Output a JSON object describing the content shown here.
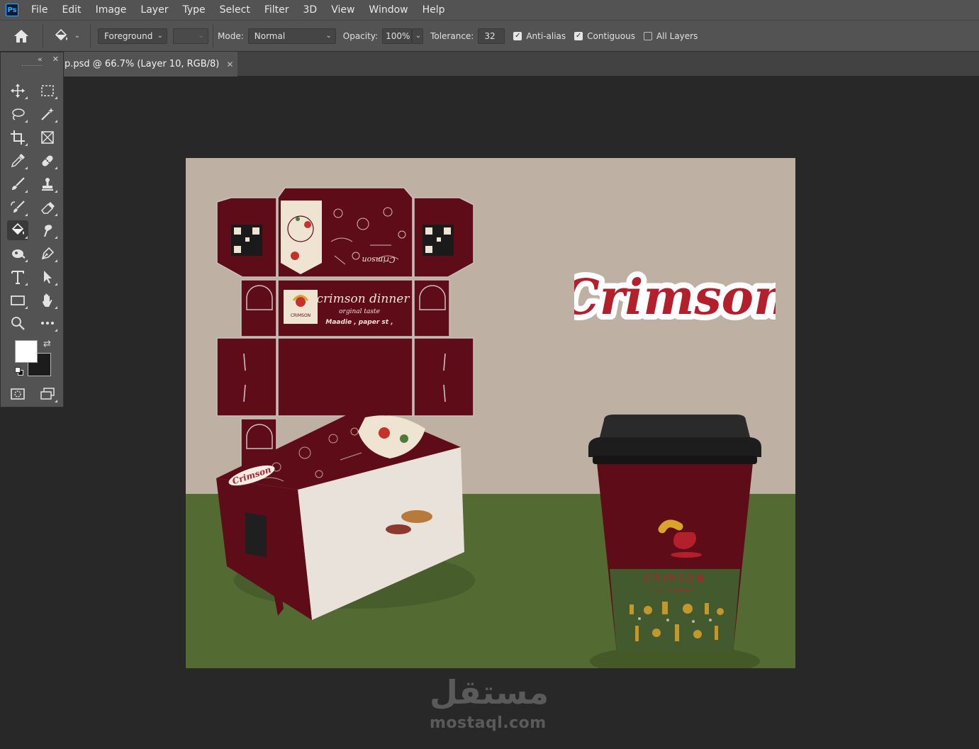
{
  "menubar": {
    "logo": "Ps",
    "items": [
      "File",
      "Edit",
      "Image",
      "Layer",
      "Type",
      "Select",
      "Filter",
      "3D",
      "View",
      "Window",
      "Help"
    ]
  },
  "options": {
    "fill_source": "Foreground",
    "mode_label": "Mode:",
    "mode_value": "Normal",
    "opacity_label": "Opacity:",
    "opacity_value": "100%",
    "tolerance_label": "Tolerance:",
    "tolerance_value": "32",
    "anti_alias_label": "Anti-alias",
    "contiguous_label": "Contiguous",
    "all_layers_label": "All Layers",
    "anti_alias_checked": true,
    "contiguous_checked": true,
    "all_layers_checked": false
  },
  "document": {
    "tab_title": "p.psd @ 66.7% (Layer 10, RGB/8)",
    "close_glyph": "✕"
  },
  "toolbox": {
    "collapse_glyph": "«",
    "close_glyph": "✕",
    "active_tool": "paint-bucket-tool",
    "foreground_color": "#ffffff",
    "background_color": "#1c1c1c"
  },
  "artwork": {
    "brand_title": "Crimson",
    "box_heading": "crimson dinner",
    "box_subheading": "orginal taste",
    "box_address": "Maadie , paper st ,",
    "box_logo_text": "CRIMSON",
    "cup_brand": "CRIMSON",
    "cup_sub": "RESTAURANT",
    "lid_label": "Crimson",
    "colors": {
      "crimson": "#5e0c18",
      "logo_red": "#b3202b",
      "cream": "#efe4d2",
      "backdrop": "#bfb0a4",
      "floor": "#536a33",
      "cup_green": "#425a2d"
    }
  },
  "watermark": {
    "arabic": "مستقل",
    "latin": "mostaql.com"
  }
}
